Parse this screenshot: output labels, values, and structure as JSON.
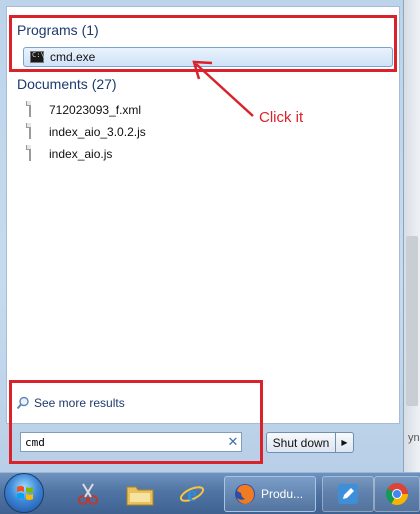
{
  "programs": {
    "header": "Programs (1)",
    "items": [
      {
        "label": "cmd.exe",
        "icon": "cmd-icon"
      }
    ]
  },
  "documents": {
    "header": "Documents (27)",
    "items": [
      {
        "label": "712023093_f.xml",
        "icon": "document-icon"
      },
      {
        "label": "index_aio_3.0.2.js",
        "icon": "document-icon"
      },
      {
        "label": "index_aio.js",
        "icon": "document-icon"
      }
    ]
  },
  "annotation": {
    "text": "Click it",
    "color": "#d9222a"
  },
  "see_more": {
    "label": "See more results"
  },
  "search": {
    "value": "cmd"
  },
  "shutdown": {
    "label": "Shut down"
  },
  "desktop": {
    "partial_text": "yn"
  },
  "taskbar": {
    "items": [
      {
        "name": "start-orb",
        "icon": "windows-logo-icon"
      },
      {
        "name": "snipping-tool",
        "icon": "scissors-icon"
      },
      {
        "name": "explorer",
        "icon": "folder-icon"
      },
      {
        "name": "internet-explorer",
        "icon": "ie-icon"
      },
      {
        "name": "firefox",
        "icon": "firefox-icon",
        "label": "Produ..."
      },
      {
        "name": "notepad",
        "icon": "pen-icon"
      },
      {
        "name": "chrome",
        "icon": "chrome-icon"
      }
    ]
  }
}
